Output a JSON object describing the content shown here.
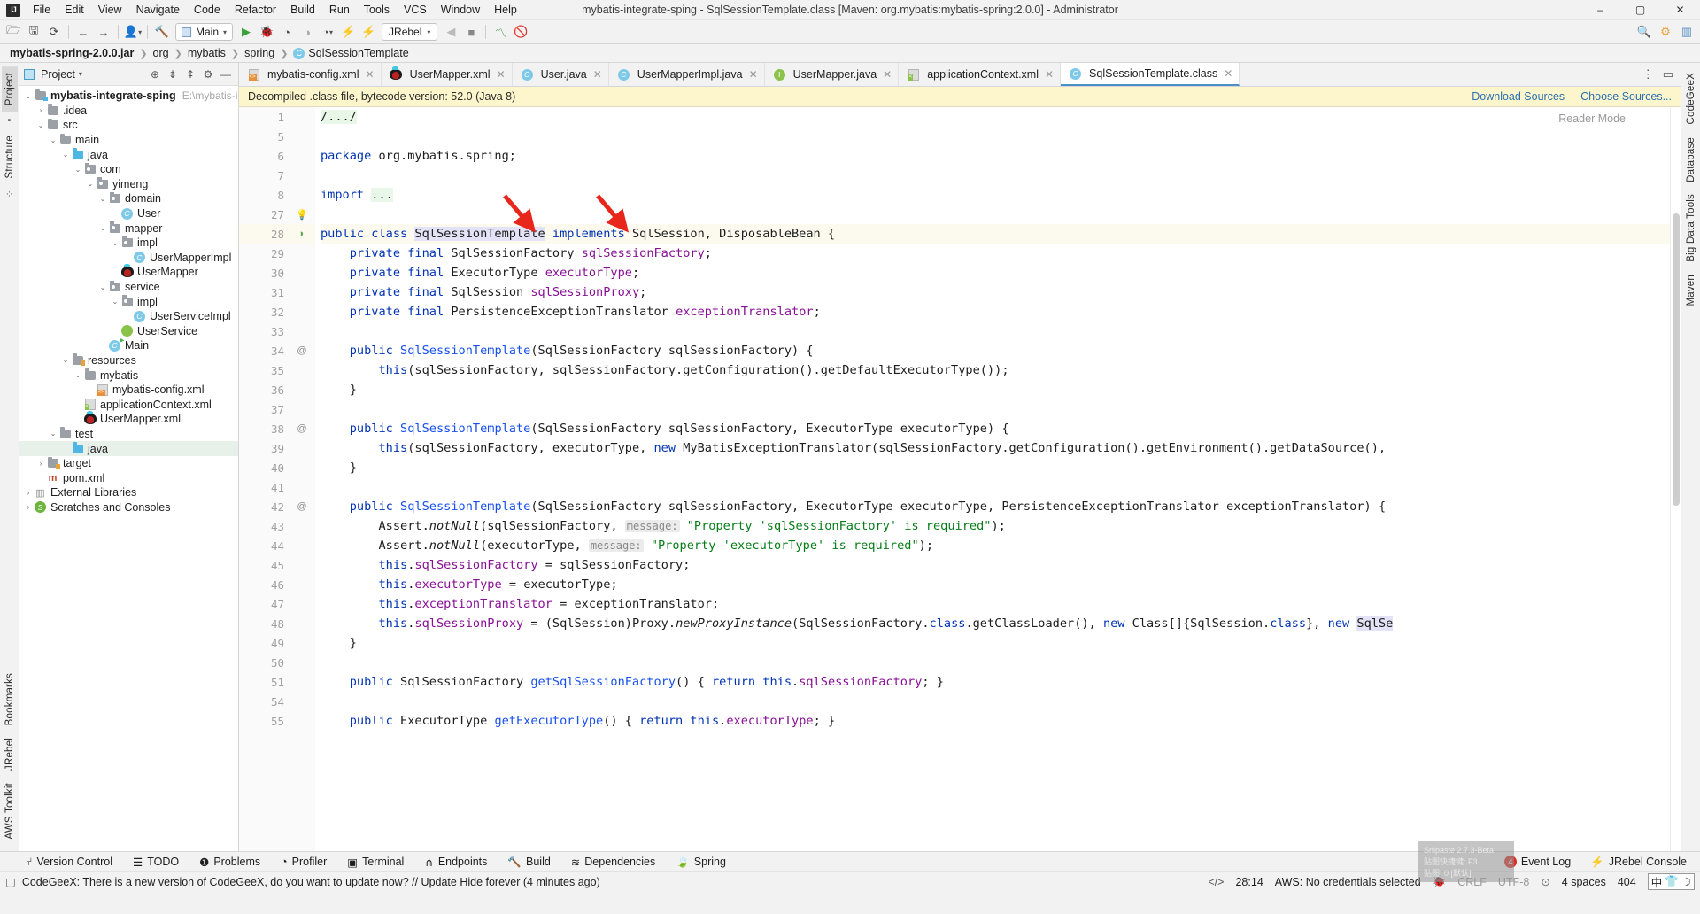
{
  "window": {
    "title": "mybatis-integrate-sping - SqlSessionTemplate.class [Maven: org.mybatis:mybatis-spring:2.0.0] - Administrator",
    "minimize": "–",
    "maximize": "▢",
    "close": "✕",
    "logo": "IJ"
  },
  "menu": [
    "File",
    "Edit",
    "View",
    "Navigate",
    "Code",
    "Refactor",
    "Build",
    "Run",
    "Tools",
    "VCS",
    "Window",
    "Help"
  ],
  "toolbar": {
    "run_config": "Main",
    "jrebel": "JRebel",
    "icons": [
      "open-folder-icon",
      "save-icon",
      "sync-icon",
      "back-arrow-icon",
      "forward-arrow-icon",
      "profile-icon",
      "build-hammer-icon",
      "run-icon",
      "debug-icon",
      "run-coverage-icon",
      "profiler-icon",
      "rerun-icon",
      "jrebel-run-icon",
      "jrebel-debug-icon",
      "stop-icon",
      "search-everywhere-icon"
    ]
  },
  "breadcrumb": [
    {
      "label": "mybatis-spring-2.0.0.jar",
      "bold": true
    },
    {
      "label": "org",
      "bold": false
    },
    {
      "label": "mybatis",
      "bold": false
    },
    {
      "label": "spring",
      "bold": false
    },
    {
      "label": "SqlSessionTemplate",
      "bold": false,
      "icon": "class-icon"
    }
  ],
  "left_rail": {
    "tabs": [
      "Project",
      "Structure",
      "Bookmarks",
      "JRebel",
      "AWS Toolkit"
    ]
  },
  "right_rail": {
    "tabs": [
      "CodeGeeX",
      "Database",
      "Big Data Tools",
      "Maven"
    ]
  },
  "project_panel": {
    "title": "Project",
    "tree": [
      {
        "depth": 0,
        "arrow": "v",
        "icon": "module-folder",
        "label": "mybatis-integrate-sping",
        "bold": true,
        "dim": "E:\\mybatis-integrat"
      },
      {
        "depth": 1,
        "arrow": ">",
        "icon": "folder",
        "label": ".idea"
      },
      {
        "depth": 1,
        "arrow": "v",
        "icon": "folder-src",
        "label": "src"
      },
      {
        "depth": 2,
        "arrow": "v",
        "icon": "folder",
        "label": "main"
      },
      {
        "depth": 3,
        "arrow": "v",
        "icon": "folder-blue",
        "label": "java"
      },
      {
        "depth": 4,
        "arrow": "v",
        "icon": "package",
        "label": "com"
      },
      {
        "depth": 5,
        "arrow": "v",
        "icon": "package",
        "label": "yimeng"
      },
      {
        "depth": 6,
        "arrow": "v",
        "icon": "package",
        "label": "domain"
      },
      {
        "depth": 7,
        "arrow": "",
        "icon": "class",
        "label": "User"
      },
      {
        "depth": 6,
        "arrow": "v",
        "icon": "package",
        "label": "mapper"
      },
      {
        "depth": 7,
        "arrow": "v",
        "icon": "package",
        "label": "impl"
      },
      {
        "depth": 8,
        "arrow": "",
        "icon": "class",
        "label": "UserMapperImpl"
      },
      {
        "depth": 7,
        "arrow": "",
        "icon": "mybatis",
        "label": "UserMapper"
      },
      {
        "depth": 6,
        "arrow": "v",
        "icon": "package",
        "label": "service"
      },
      {
        "depth": 7,
        "arrow": "v",
        "icon": "package",
        "label": "impl"
      },
      {
        "depth": 8,
        "arrow": "",
        "icon": "class",
        "label": "UserServiceImpl"
      },
      {
        "depth": 7,
        "arrow": "",
        "icon": "interface",
        "label": "UserService"
      },
      {
        "depth": 6,
        "arrow": "",
        "icon": "class-run",
        "label": "Main"
      },
      {
        "depth": 3,
        "arrow": "v",
        "icon": "folder-res",
        "label": "resources"
      },
      {
        "depth": 4,
        "arrow": "v",
        "icon": "folder",
        "label": "mybatis"
      },
      {
        "depth": 5,
        "arrow": "",
        "icon": "xml",
        "label": "mybatis-config.xml"
      },
      {
        "depth": 4,
        "arrow": "",
        "icon": "xml-spring",
        "label": "applicationContext.xml"
      },
      {
        "depth": 4,
        "arrow": "",
        "icon": "mybatis",
        "label": "UserMapper.xml"
      },
      {
        "depth": 2,
        "arrow": "v",
        "icon": "folder",
        "label": "test"
      },
      {
        "depth": 3,
        "arrow": "",
        "icon": "folder-blue",
        "label": "java",
        "selected": true
      },
      {
        "depth": 1,
        "arrow": ">",
        "icon": "folder-tgt",
        "label": "target"
      },
      {
        "depth": 1,
        "arrow": "",
        "icon": "maven",
        "label": "pom.xml"
      },
      {
        "depth": 0,
        "arrow": ">",
        "icon": "libs",
        "label": "External Libraries"
      },
      {
        "depth": 0,
        "arrow": ">",
        "icon": "scratch",
        "label": "Scratches and Consoles"
      }
    ]
  },
  "editor": {
    "tabs": [
      {
        "label": "mybatis-config.xml",
        "icon": "xml-icon",
        "active": false
      },
      {
        "label": "UserMapper.xml",
        "icon": "mybatis-icon",
        "active": false
      },
      {
        "label": "User.java",
        "icon": "class-icon",
        "active": false
      },
      {
        "label": "UserMapperImpl.java",
        "icon": "class-icon",
        "active": false
      },
      {
        "label": "UserMapper.java",
        "icon": "interface-icon",
        "active": false
      },
      {
        "label": "applicationContext.xml",
        "icon": "xml-spring-icon",
        "active": false
      },
      {
        "label": "SqlSessionTemplate.class",
        "icon": "class-file-icon",
        "active": true
      }
    ],
    "notice": "Decompiled .class file, bytecode version: 52.0 (Java 8)",
    "notice_links": [
      "Download Sources",
      "Choose Sources..."
    ],
    "reader_mode": "Reader Mode",
    "lines": [
      {
        "num": "1",
        "annot": "",
        "fold": "+",
        "html": "<span class=\"fgreen\">/.../</span>"
      },
      {
        "num": "5",
        "annot": "",
        "fold": "",
        "html": ""
      },
      {
        "num": "6",
        "annot": "",
        "fold": "",
        "html": "<span class=\"kw\">package</span> org.mybatis.spring;"
      },
      {
        "num": "7",
        "annot": "",
        "fold": "",
        "html": ""
      },
      {
        "num": "8",
        "annot": "",
        "fold": "+",
        "html": "<span class=\"kw\">import</span> <span class=\"fgreen\">...</span>"
      },
      {
        "num": "27",
        "annot": "bulb",
        "fold": "",
        "html": ""
      },
      {
        "num": "28",
        "annot": "green-leaf",
        "fold": "",
        "highlight": true,
        "html": "<span class=\"kw\">public class</span> <span class=\"selword\">SqlSessionTemplate</span> <span class=\"kw\">implements</span> SqlSession, DisposableBean {"
      },
      {
        "num": "29",
        "annot": "",
        "fold": "",
        "html": "    <span class=\"kw\">private final</span> SqlSessionFactory <span class=\"fld\">sqlSessionFactory</span>;"
      },
      {
        "num": "30",
        "annot": "",
        "fold": "",
        "html": "    <span class=\"kw\">private final</span> ExecutorType <span class=\"fld\">executorType</span>;"
      },
      {
        "num": "31",
        "annot": "",
        "fold": "",
        "html": "    <span class=\"kw\">private final</span> SqlSession <span class=\"fld\">sqlSessionProxy</span>;"
      },
      {
        "num": "32",
        "annot": "",
        "fold": "",
        "html": "    <span class=\"kw\">private final</span> PersistenceExceptionTranslator <span class=\"fld\">exceptionTranslator</span>;"
      },
      {
        "num": "33",
        "annot": "",
        "fold": "",
        "html": ""
      },
      {
        "num": "34",
        "annot": "@",
        "fold": "-",
        "html": "    <span class=\"kw\">public</span> <span class=\"mth\">SqlSessionTemplate</span>(SqlSessionFactory sqlSessionFactory) {"
      },
      {
        "num": "35",
        "annot": "",
        "fold": "",
        "html": "        <span class=\"kw\">this</span>(sqlSessionFactory, sqlSessionFactory.getConfiguration().getDefaultExecutorType());"
      },
      {
        "num": "36",
        "annot": "",
        "fold": "c",
        "html": "    }"
      },
      {
        "num": "37",
        "annot": "",
        "fold": "",
        "html": ""
      },
      {
        "num": "38",
        "annot": "@",
        "fold": "-",
        "html": "    <span class=\"kw\">public</span> <span class=\"mth\">SqlSessionTemplate</span>(SqlSessionFactory sqlSessionFactory, ExecutorType executorType) {"
      },
      {
        "num": "39",
        "annot": "",
        "fold": "",
        "html": "        <span class=\"kw\">this</span>(sqlSessionFactory, executorType, <span class=\"kw\">new</span> MyBatisExceptionTranslator(sqlSessionFactory.getConfiguration().getEnvironment().getDataSource(),"
      },
      {
        "num": "40",
        "annot": "",
        "fold": "c",
        "html": "    }"
      },
      {
        "num": "41",
        "annot": "",
        "fold": "",
        "html": ""
      },
      {
        "num": "42",
        "annot": "@",
        "fold": "-",
        "html": "    <span class=\"kw\">public</span> <span class=\"mth\">SqlSessionTemplate</span>(SqlSessionFactory sqlSessionFactory, ExecutorType executorType, PersistenceExceptionTranslator exceptionTranslator) {"
      },
      {
        "num": "43",
        "annot": "",
        "fold": "",
        "html": "        Assert.<span class=\"ital\">notNull</span>(sqlSessionFactory, <span class=\"hint\">message:</span> <span class=\"str\">\"Property 'sqlSessionFactory' is required\"</span>);"
      },
      {
        "num": "44",
        "annot": "",
        "fold": "",
        "html": "        Assert.<span class=\"ital\">notNull</span>(executorType, <span class=\"hint\">message:</span> <span class=\"str\">\"Property 'executorType' is required\"</span>);"
      },
      {
        "num": "45",
        "annot": "",
        "fold": "",
        "html": "        <span class=\"kw\">this</span>.<span class=\"fld\">sqlSessionFactory</span> = sqlSessionFactory;"
      },
      {
        "num": "46",
        "annot": "",
        "fold": "",
        "html": "        <span class=\"kw\">this</span>.<span class=\"fld\">executorType</span> = executorType;"
      },
      {
        "num": "47",
        "annot": "",
        "fold": "",
        "html": "        <span class=\"kw\">this</span>.<span class=\"fld\">exceptionTranslator</span> = exceptionTranslator;"
      },
      {
        "num": "48",
        "annot": "",
        "fold": "",
        "html": "        <span class=\"kw\">this</span>.<span class=\"fld\">sqlSessionProxy</span> = (SqlSession)Proxy.<span class=\"ital\">newProxyInstance</span>(SqlSessionFactory.<span class=\"kw\">class</span>.getClassLoader(), <span class=\"kw\">new</span> Class[]{SqlSession.<span class=\"kw\">class</span>}, <span class=\"kw\">new</span> <span class=\"selword\">SqlSe</span>"
      },
      {
        "num": "49",
        "annot": "",
        "fold": "c",
        "html": "    }"
      },
      {
        "num": "50",
        "annot": "",
        "fold": "",
        "html": ""
      },
      {
        "num": "51",
        "annot": "",
        "fold": "",
        "html": "    <span class=\"kw\">public</span> SqlSessionFactory <span class=\"mth\">getSqlSessionFactory</span>() { <span class=\"kw\">return</span> <span class=\"kw\">this</span>.<span class=\"fld\">sqlSessionFactory</span>; }"
      },
      {
        "num": "54",
        "annot": "",
        "fold": "",
        "html": ""
      },
      {
        "num": "55",
        "annot": "",
        "fold": "+",
        "html": "    <span class=\"kw\">public</span> ExecutorType <span class=\"mth\">getExecutorType</span>() { <span class=\"kw\">return</span> <span class=\"kw\">this</span>.<span class=\"fld\">executorType</span>; }"
      }
    ]
  },
  "tool_windows": {
    "items": [
      {
        "label": "Version Control",
        "icon": "branch-icon"
      },
      {
        "label": "TODO",
        "icon": "list-icon"
      },
      {
        "label": "Problems",
        "icon": "error-icon"
      },
      {
        "label": "Profiler",
        "icon": "gauge-icon"
      },
      {
        "label": "Terminal",
        "icon": "terminal-icon"
      },
      {
        "label": "Endpoints",
        "icon": "endpoints-icon"
      },
      {
        "label": "Build",
        "icon": "hammer-icon"
      },
      {
        "label": "Dependencies",
        "icon": "stack-icon"
      },
      {
        "label": "Spring",
        "icon": "spring-leaf-icon"
      }
    ],
    "right": [
      {
        "label": "Event Log",
        "icon": "bell-icon",
        "badge": "4"
      },
      {
        "label": "JRebel Console",
        "icon": "jrebel-icon"
      }
    ]
  },
  "status_bar": {
    "message": "CodeGeeX: There is a new version of CodeGeeX, do you want to update now? // Update   Hide forever (4 minutes ago)",
    "caret": "28:14",
    "aws": "AWS: No credentials selected",
    "line_sep": "CRLF",
    "encoding": "UTF-8",
    "indent": "4 spaces",
    "memory": "404",
    "ime": "中"
  },
  "toast": {
    "line1": "Snipaste 2.7.3-Beta",
    "line2": "贴图快捷键: F3",
    "line3": "贴图: 0 [默认]"
  },
  "colors": {
    "accent": "#4a90c4",
    "keyword": "#0033b3",
    "field": "#871094",
    "string": "#067d17",
    "method": "#1750eb",
    "notice_bg": "#fdf6cd",
    "arrow_red": "#e8261c"
  }
}
